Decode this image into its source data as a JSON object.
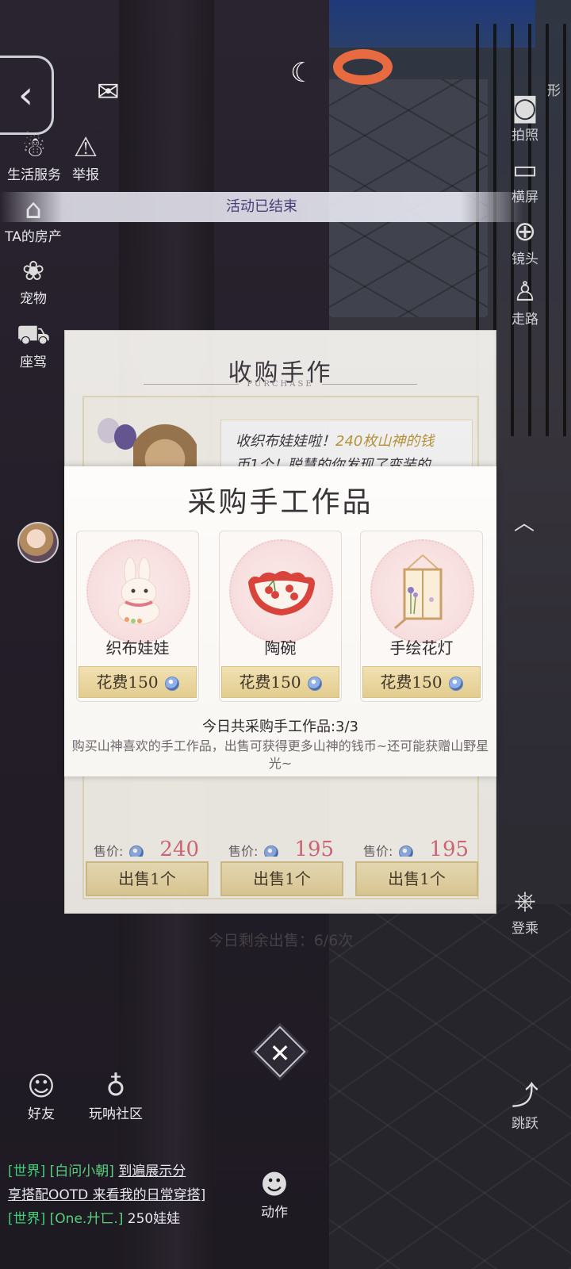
{
  "status_bar": {
    "partial_text": "形"
  },
  "left_hud": [
    {
      "label": "生活服务",
      "icon": "service-icon"
    },
    {
      "label": "举报",
      "icon": "siren-icon"
    },
    {
      "label": "TA的房产",
      "icon": "house-icon"
    },
    {
      "label": "宠物",
      "icon": "paw-icon"
    },
    {
      "label": "座驾",
      "icon": "car-icon"
    }
  ],
  "right_hud": [
    {
      "label": "拍照",
      "icon": "camera-icon"
    },
    {
      "label": "横屏",
      "icon": "rotate-screen-icon"
    },
    {
      "label": "镜头",
      "icon": "lens-icon"
    },
    {
      "label": "走路",
      "icon": "walk-icon"
    },
    {
      "label": "登乘",
      "icon": "steering-wheel-icon"
    },
    {
      "label": "跳跃",
      "icon": "jump-icon"
    }
  ],
  "bottom_hud": [
    {
      "label": "好友",
      "icon": "friends-icon"
    },
    {
      "label": "玩呐社区",
      "icon": "planet-icon"
    },
    {
      "label": "动作",
      "icon": "emote-icon"
    }
  ],
  "banner": {
    "text": "活动已结束"
  },
  "back_panel": {
    "title": "收购手作",
    "subtitle": "PURCHASE",
    "quote_prefix": "收织布娃娃啦！",
    "quote_highlight": "240枚山神的钱",
    "quote_rest": "币1个！聪慧的你发现了变装的",
    "sell_items": [
      {
        "price_label": "售价:",
        "price": "240",
        "button": "出售1个"
      },
      {
        "price_label": "售价:",
        "price": "195",
        "button": "出售1个"
      },
      {
        "price_label": "售价:",
        "price": "195",
        "button": "出售1个"
      }
    ],
    "remaining_label": "今日剩余出售：6/6次"
  },
  "front_panel": {
    "title": "采购手工作品",
    "items": [
      {
        "name": "织布娃娃",
        "cost": "花费150",
        "art": "rabbit-doll-icon"
      },
      {
        "name": "陶碗",
        "cost": "花费150",
        "art": "cherry-bowl-icon"
      },
      {
        "name": "手绘花灯",
        "cost": "花费150",
        "art": "flower-lantern-icon"
      }
    ],
    "daily_count": "今日共采购手工作品:3/3",
    "description": "购买山神喜欢的手工作品，出售可获得更多山神的钱币~还可能获赠山野星光~"
  },
  "close_button": {
    "label": "✕"
  },
  "chat": [
    {
      "channel": "[世界]",
      "sender": "[白问小朝]",
      "message": "到遍展示分"
    },
    {
      "channel": "",
      "sender": "",
      "message": "享搭配OOTD 来看我的日常穿搭]"
    },
    {
      "channel": "[世界]",
      "sender": "[One.廾匸.]",
      "message": "250娃娃"
    }
  ],
  "colors": {
    "accent_gold": "#e2cc8f",
    "price_pink": "#d96a7a",
    "chat_channel": "#3fd07a",
    "banner_text": "#4a3f78"
  }
}
